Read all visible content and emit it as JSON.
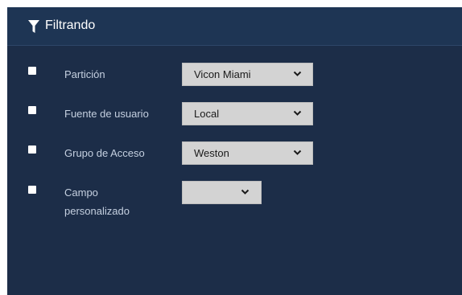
{
  "header": {
    "title": "Filtrando",
    "icon": "filter-icon"
  },
  "filters": [
    {
      "label": "Partición",
      "value": "Vicon Miami",
      "checked": false
    },
    {
      "label": "Fuente de usuario",
      "value": "Local",
      "checked": false
    },
    {
      "label": "Grupo de Acceso",
      "value": "Weston",
      "checked": false
    },
    {
      "label_line1": "Campo",
      "label_line2": "personalizado",
      "value": "",
      "checked": false
    }
  ],
  "colors": {
    "panel_bg": "#1c2d48",
    "header_bg": "#1e3554",
    "select_bg": "#d3d3d3",
    "label_text": "#c5d0e0"
  }
}
